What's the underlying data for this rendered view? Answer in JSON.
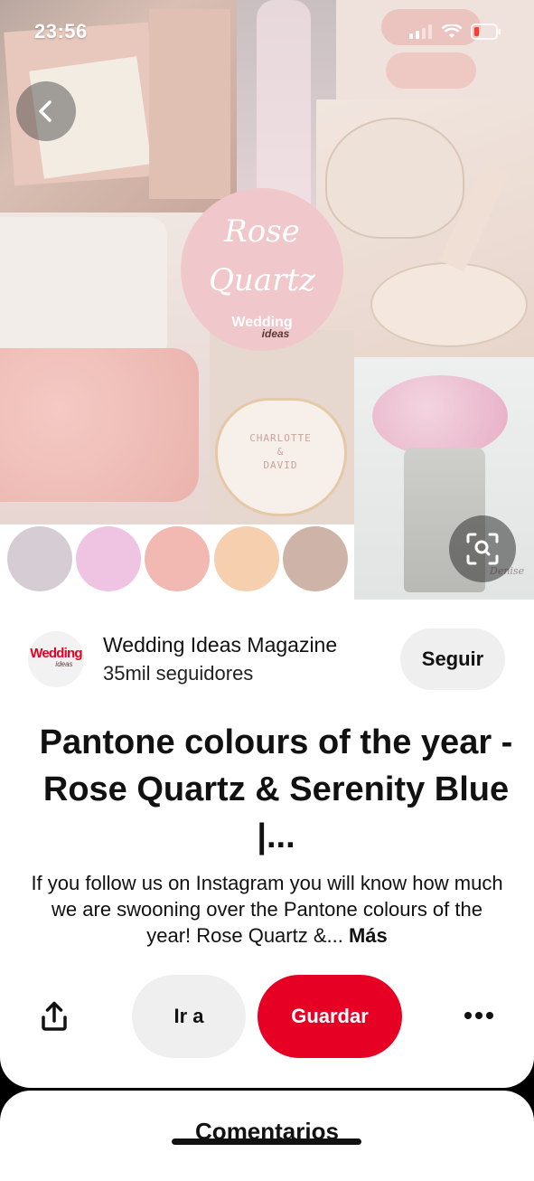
{
  "status_bar": {
    "time": "23:56"
  },
  "pin": {
    "badge": {
      "line1": "Rose",
      "line2": "Quartz",
      "brand": "Wedding",
      "brand_sub": "ideas"
    },
    "cookie_text": {
      "line1": "CHARLOTTE",
      "line2": "&",
      "line3": "DAVID"
    },
    "watermark": "Denise",
    "swatches": [
      "#d6ccd4",
      "#eec4e2",
      "#f2b9b2",
      "#f5cfae",
      "#cdb3a8"
    ]
  },
  "publisher": {
    "avatar_text": "Wedding",
    "avatar_sub": "ideas",
    "name": "Wedding Ideas Magazine",
    "followers": "35mil seguidores",
    "follow_label": "Seguir"
  },
  "title": "Pantone colours of the year - Rose Quartz & Serenity Blue |...",
  "description": "If you follow us on Instagram you will know how much we are swooning over the Pantone colours of the year! Rose Quartz &...",
  "more_label": "Más",
  "actions": {
    "goto_label": "Ir a",
    "save_label": "Guardar"
  },
  "comments_title": "Comentarios",
  "colors": {
    "accent": "#e60023",
    "button_gray": "#efefef"
  },
  "icons": [
    "back-icon",
    "wifi-icon",
    "signal-icon",
    "battery-icon",
    "visual-search-icon",
    "share-icon",
    "more-icon"
  ]
}
